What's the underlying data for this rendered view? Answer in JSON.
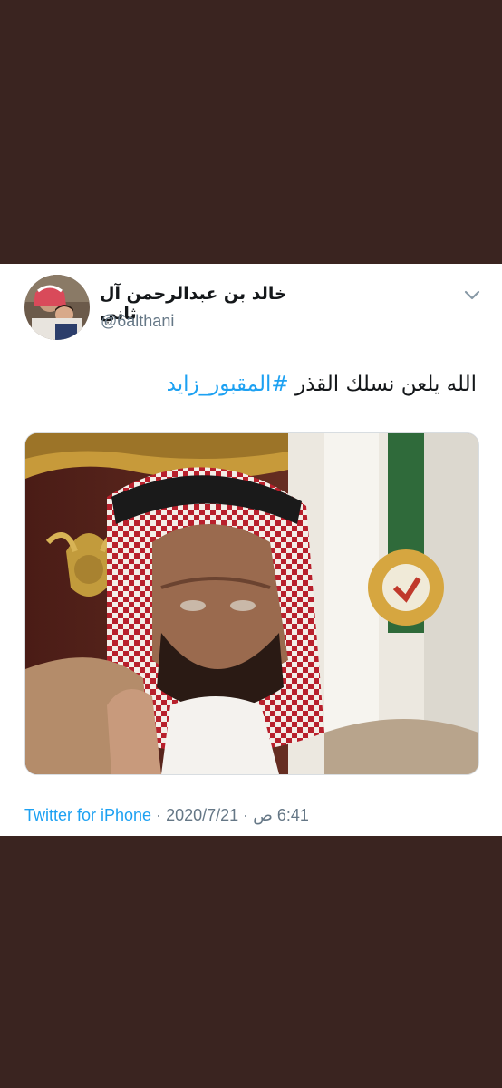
{
  "tweet": {
    "display_name": "خالد بن عبدالرحمن آل ثاني",
    "handle": "@6althani",
    "text_plain": "الله يلعن نسلك القذر ",
    "hashtag": "#المقبور_زايد",
    "source": "Twitter for iPhone",
    "separator": " · ",
    "date": "2020/7/21",
    "time": "6:41 ص"
  },
  "icons": {
    "menu": "chevron-down-icon"
  },
  "colors": {
    "background": "#3a2420",
    "link": "#1da1f2",
    "secondary_text": "#657786",
    "primary_text": "#14171a"
  }
}
